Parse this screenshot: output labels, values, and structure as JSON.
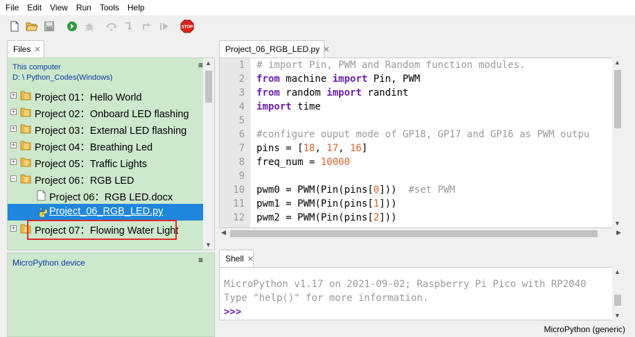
{
  "menu": [
    "File",
    "Edit",
    "View",
    "Run",
    "Tools",
    "Help"
  ],
  "toolbar": {
    "icons": [
      "new-file-icon",
      "open-folder-icon",
      "save-icon",
      "run-icon",
      "debug-icon",
      "step-over-icon",
      "step-into-icon",
      "step-out-icon",
      "resume-icon",
      "stop-icon"
    ],
    "stop_label": "STOP"
  },
  "files": {
    "tab_label": "Files",
    "close_glyph": "✕",
    "menu_glyph": "≡",
    "location_title": "This computer",
    "location_path": "D: \\ Python_Codes(Windows)",
    "tree": [
      {
        "label": "Project 01：Hello World",
        "expander": "+"
      },
      {
        "label": "Project 02：Onboard LED flashing",
        "expander": "+"
      },
      {
        "label": "Project 03：External LED flashing",
        "expander": "+"
      },
      {
        "label": "Project 04：Breathing Led",
        "expander": "+"
      },
      {
        "label": "Project 05：Traffic Lights",
        "expander": "+"
      },
      {
        "label": "Project 06：RGB LED",
        "expander": "−"
      },
      {
        "label": "Project 06：RGB LED.docx"
      },
      {
        "label": "Project_06_RGB_LED.py"
      },
      {
        "label": "Project 07：Flowing Water Light",
        "expander": "+"
      }
    ]
  },
  "device": {
    "title": "MicroPython device",
    "menu_glyph": "≡"
  },
  "editor": {
    "tab_label": "Project_06_RGB_LED.py",
    "close_glyph": "✕",
    "lines": [
      {
        "n": "1",
        "text": "# import Pin, PWM and Random function modules."
      },
      {
        "n": "2",
        "text": "from machine import Pin, PWM"
      },
      {
        "n": "3",
        "text": "from random import randint"
      },
      {
        "n": "4",
        "text": "import time"
      },
      {
        "n": "5",
        "text": ""
      },
      {
        "n": "6",
        "text": "#configure ouput mode of GP18, GP17 and GP16 as PWM outpu"
      },
      {
        "n": "7",
        "text": "pins = [18, 17, 16]"
      },
      {
        "n": "8",
        "text": "freq_num = 10000"
      },
      {
        "n": "9",
        "text": ""
      },
      {
        "n": "10",
        "text": "pwm0 = PWM(Pin(pins[0]))  #set PWM"
      },
      {
        "n": "11",
        "text": "pwm1 = PWM(Pin(pins[1]))"
      },
      {
        "n": "12",
        "text": "pwm2 = PWM(Pin(pins[2]))"
      }
    ]
  },
  "shell": {
    "tab_label": "Shell",
    "close_glyph": "✕",
    "line1": "MicroPython v1.17 on 2021-09-02; Raspberry Pi Pico with RP2040",
    "line2": "Type \"help()\" for more information.",
    "prompt": ">>>"
  },
  "status": {
    "interpreter": "MicroPython (generic)"
  },
  "colors": {
    "files_bg": "#cde8cc",
    "selected_row": "#1e86dc",
    "highlight_box": "#e02a2a",
    "keyword": "#6b1fa6",
    "comment": "#9a9a9a",
    "number": "#d9612a",
    "path_text": "#0a3aa5"
  }
}
